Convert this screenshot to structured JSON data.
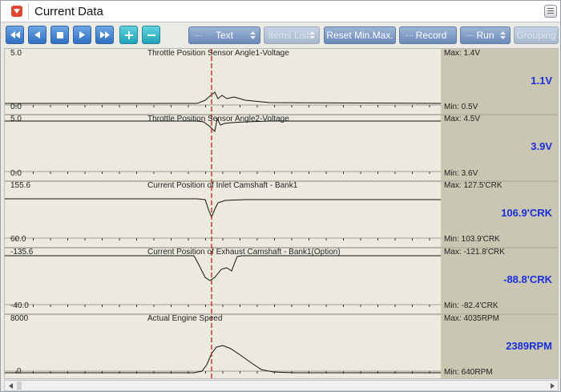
{
  "window": {
    "title": "Current Data"
  },
  "toolbar": {
    "text_label": "Text",
    "items_list_label": "Items List",
    "reset_label": "Reset Min.Max.",
    "record_label": "Record",
    "run_label": "Run",
    "grouping_label": "Grouping"
  },
  "colors": {
    "plot_bg": "#eceadf",
    "side_bg": "#c9c6b2",
    "value_blue": "#1a2edc",
    "cursor_red": "#d32a1f",
    "toolbar_blue": "#2e6fc2"
  },
  "charts": [
    {
      "title": "Throttle Position Sensor Angle1-Voltage",
      "top_label": "5.0",
      "bottom_label": "0.0",
      "max_label": "Max:  1.4V",
      "min_label": "Min:   0.5V",
      "value": "1.1V"
    },
    {
      "title": "Throttle Position Sensor Angle2-Voltage",
      "top_label": "5.0",
      "bottom_label": "0.0",
      "max_label": "Max:  4.5V",
      "min_label": "Min:   3.6V",
      "value": "3.9V"
    },
    {
      "title": "Current Position of Inlet Camshaft - Bank1",
      "top_label": "155.6",
      "bottom_label": "60.0",
      "max_label": "Max: 127.5'CRK",
      "min_label": "Min: 103.9'CRK",
      "value": "106.9'CRK"
    },
    {
      "title": "Current Position of Exhaust Camshaft - Bank1(Option)",
      "top_label": "-135.6",
      "bottom_label": "-40.0",
      "max_label": "Max: -121.8'CRK",
      "min_label": "Min: -82.4'CRK",
      "value": "-88.8'CRK"
    },
    {
      "title": "Actual Engine Speed",
      "top_label": "8000",
      "bottom_label": "0",
      "max_label": "Max:  4035RPM",
      "min_label": "Min:    640RPM",
      "value": "2389RPM"
    }
  ]
}
